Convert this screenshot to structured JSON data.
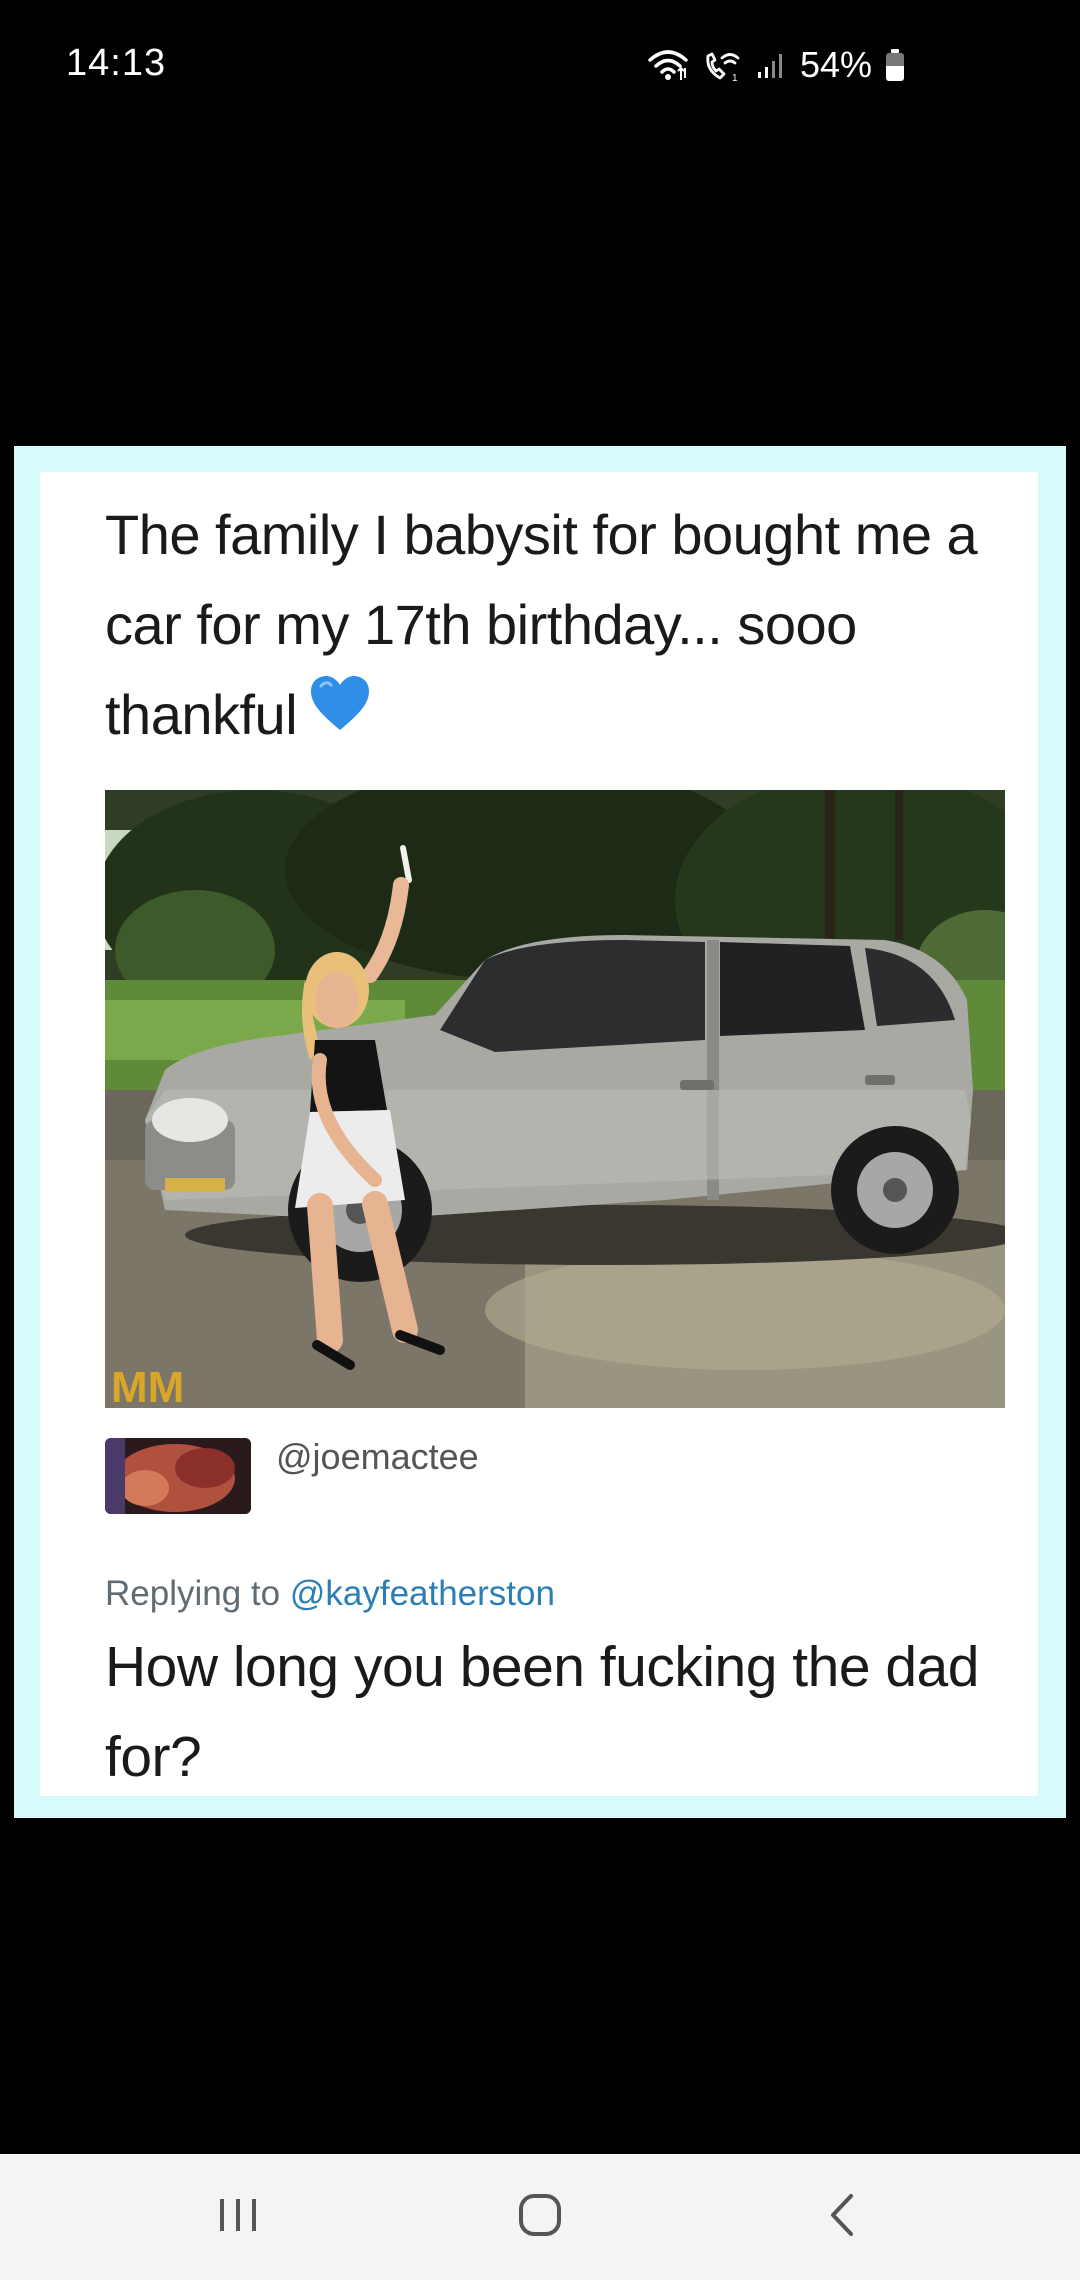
{
  "status_bar": {
    "time": "14:13",
    "battery_percent": "54%",
    "battery_level": 0.54,
    "icons": [
      "wifi-icon",
      "wifi-calling-icon",
      "signal-icon",
      "battery-icon"
    ]
  },
  "meme": {
    "tweet_text": "The family I babysit for bought me a car for my 17th birthday... sooo thankful",
    "tweet_emoji": "blue-heart-icon",
    "photo_description_icon": "photo-car-girl",
    "photo_watermark": "MM",
    "reply": {
      "handle": "@joemactee",
      "replying_to_prefix": "Replying to",
      "replying_to_user": "@kayfeatherston",
      "text": "How long you been fucking the dad for?"
    }
  },
  "nav_bar": {
    "buttons": [
      "recents-button",
      "home-button",
      "back-button"
    ]
  },
  "colors": {
    "frame": "#d6fbfb",
    "mention": "#2c7fb4",
    "heart": "#2f8fe6"
  }
}
